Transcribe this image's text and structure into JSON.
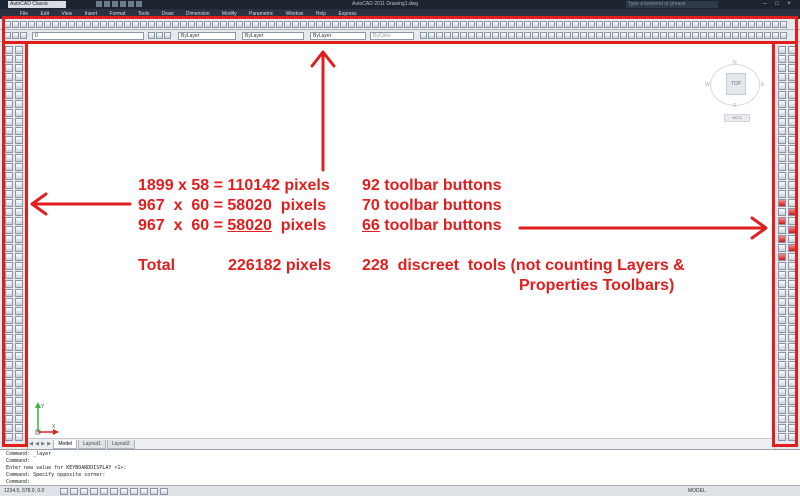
{
  "titlebar": {
    "workspace": "AutoCAD Classic",
    "title": "AutoCAD 2011   Drawing1.dwg",
    "search_placeholder": "Type a keyword or phrase"
  },
  "menubar": {
    "items": [
      "File",
      "Edit",
      "View",
      "Insert",
      "Format",
      "Tools",
      "Draw",
      "Dimension",
      "Modify",
      "Parametric",
      "Window",
      "Help",
      "Express"
    ]
  },
  "layers": {
    "current_layer": "0",
    "color": "ByLayer",
    "linetype": "ByLayer",
    "lineweight": "ByLayer",
    "plotstyle": "ByColor"
  },
  "viewcube": {
    "face": "TOP",
    "north": "N",
    "south": "S",
    "east": "E",
    "west": "W",
    "wcs": "WCS"
  },
  "ucs": {
    "x_label": "X",
    "y_label": "Y"
  },
  "tabs": [
    "Model",
    "Layout1",
    "Layout2"
  ],
  "command_line": {
    "lines": [
      "Command: _layer",
      "Command:",
      "Enter new value for KEYBOARDDISPLAY <1>:",
      "Command: Specify opposite corner:"
    ],
    "prompt": "Command:"
  },
  "statusbar": {
    "coords": "1234.5, 678.9, 0.0",
    "model": "MODEL"
  },
  "annotation": {
    "line1": {
      "size": "1899 x 58 = ",
      "pixels": "110142 pixels",
      "count": "92",
      "label": " toolbar buttons"
    },
    "line2": {
      "size": "967  x  60 = ",
      "pixels": "58020  pixels",
      "count": "70",
      "label": " toolbar buttons"
    },
    "line3": {
      "size": "967  x  60 = ",
      "pixels": "58020",
      "pixels_suffix": "  pixels",
      "count": "66",
      "label": " toolbar buttons"
    },
    "total": {
      "label": "Total",
      "pixels": "226182 pixels",
      "tools": "228  discreet  tools (not counting Layers &",
      "tools_cont": "Properties Toolbars)"
    }
  }
}
